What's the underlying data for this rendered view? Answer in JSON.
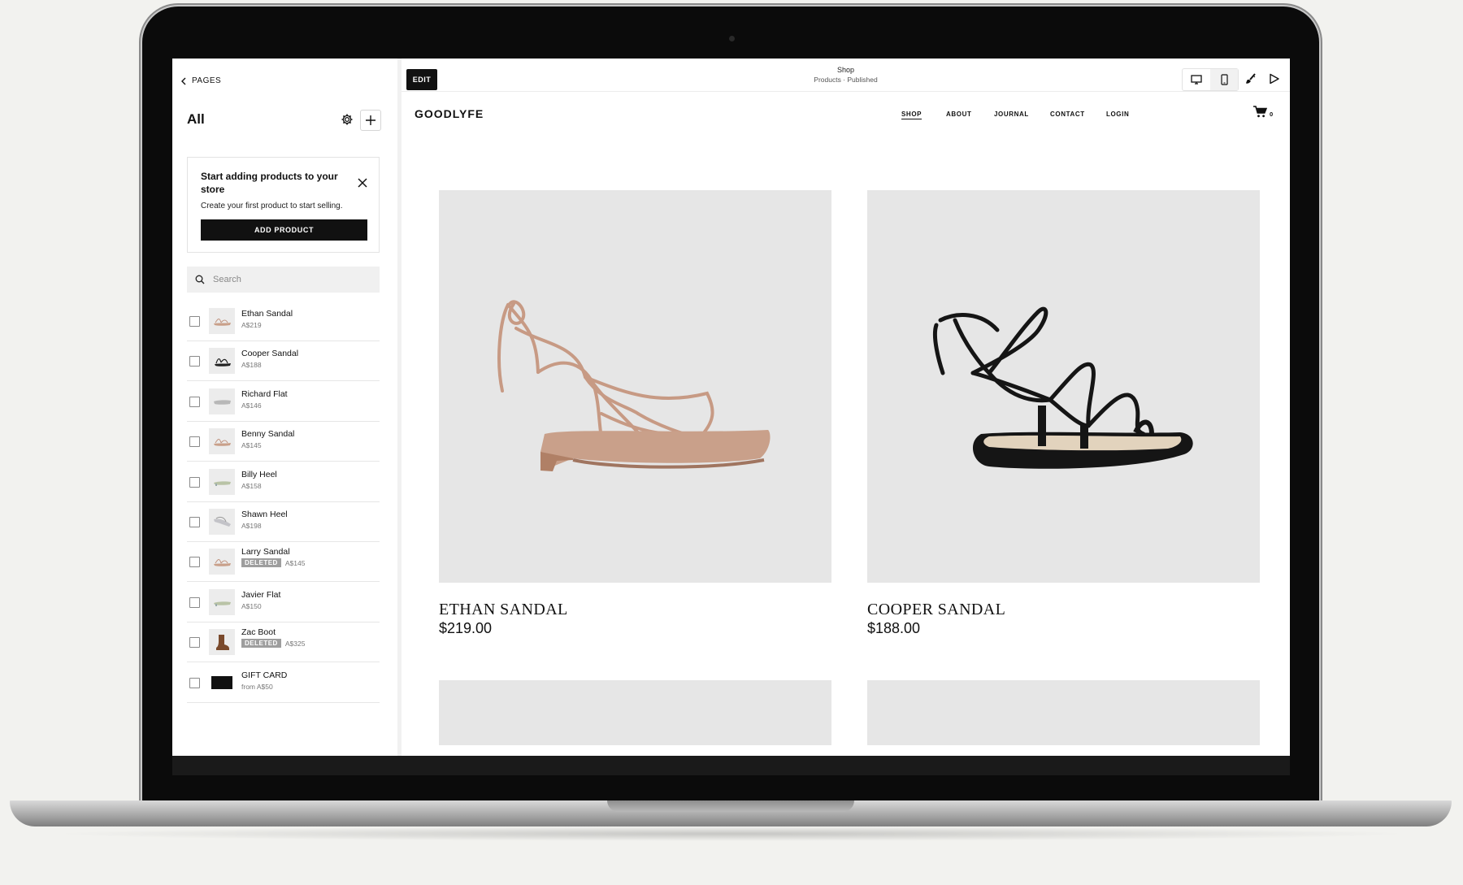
{
  "sidebar": {
    "back_label": "PAGES",
    "title": "All",
    "promo": {
      "title": "Start adding products to your store",
      "description": "Create your first product to start selling.",
      "button_label": "ADD PRODUCT"
    },
    "search_placeholder": "Search",
    "products": [
      {
        "name": "Ethan Sandal",
        "price": "A$219",
        "deleted": false,
        "thumb": "tan-sandal"
      },
      {
        "name": "Cooper Sandal",
        "price": "A$188",
        "deleted": false,
        "thumb": "black-sandal"
      },
      {
        "name": "Richard Flat",
        "price": "A$146",
        "deleted": false,
        "thumb": "grey-flat"
      },
      {
        "name": "Benny Sandal",
        "price": "A$145",
        "deleted": false,
        "thumb": "tan-sandal"
      },
      {
        "name": "Billy Heel",
        "price": "A$158",
        "deleted": false,
        "thumb": "green-heel"
      },
      {
        "name": "Shawn Heel",
        "price": "A$198",
        "deleted": false,
        "thumb": "grey-heel"
      },
      {
        "name": "Larry Sandal",
        "price": "A$145",
        "deleted": true,
        "thumb": "tan-sandal"
      },
      {
        "name": "Javier Flat",
        "price": "A$150",
        "deleted": false,
        "thumb": "green-heel"
      },
      {
        "name": "Zac Boot",
        "price": "A$325",
        "deleted": true,
        "thumb": "brown-boot"
      },
      {
        "name": "GIFT CARD",
        "price": "from A$50",
        "deleted": false,
        "thumb": "gift-card"
      }
    ],
    "deleted_badge": "DELETED"
  },
  "toolbar": {
    "edit_label": "EDIT",
    "page_title": "Shop",
    "page_status": "Products · Published"
  },
  "site": {
    "logo": "GOODLYFE",
    "nav": [
      {
        "label": "SHOP",
        "active": true
      },
      {
        "label": "ABOUT",
        "active": false
      },
      {
        "label": "JOURNAL",
        "active": false
      },
      {
        "label": "CONTACT",
        "active": false
      },
      {
        "label": "LOGIN",
        "active": false
      }
    ],
    "cart_count": "0",
    "products": [
      {
        "name": "ETHAN SANDAL",
        "price": "$219.00",
        "color": "#c79a84"
      },
      {
        "name": "COOPER SANDAL",
        "price": "$188.00",
        "color": "#141414"
      }
    ]
  },
  "colors": {
    "background": "#f2f2ef",
    "placeholder_gray": "#e6e6e6",
    "accent": "#111111"
  }
}
